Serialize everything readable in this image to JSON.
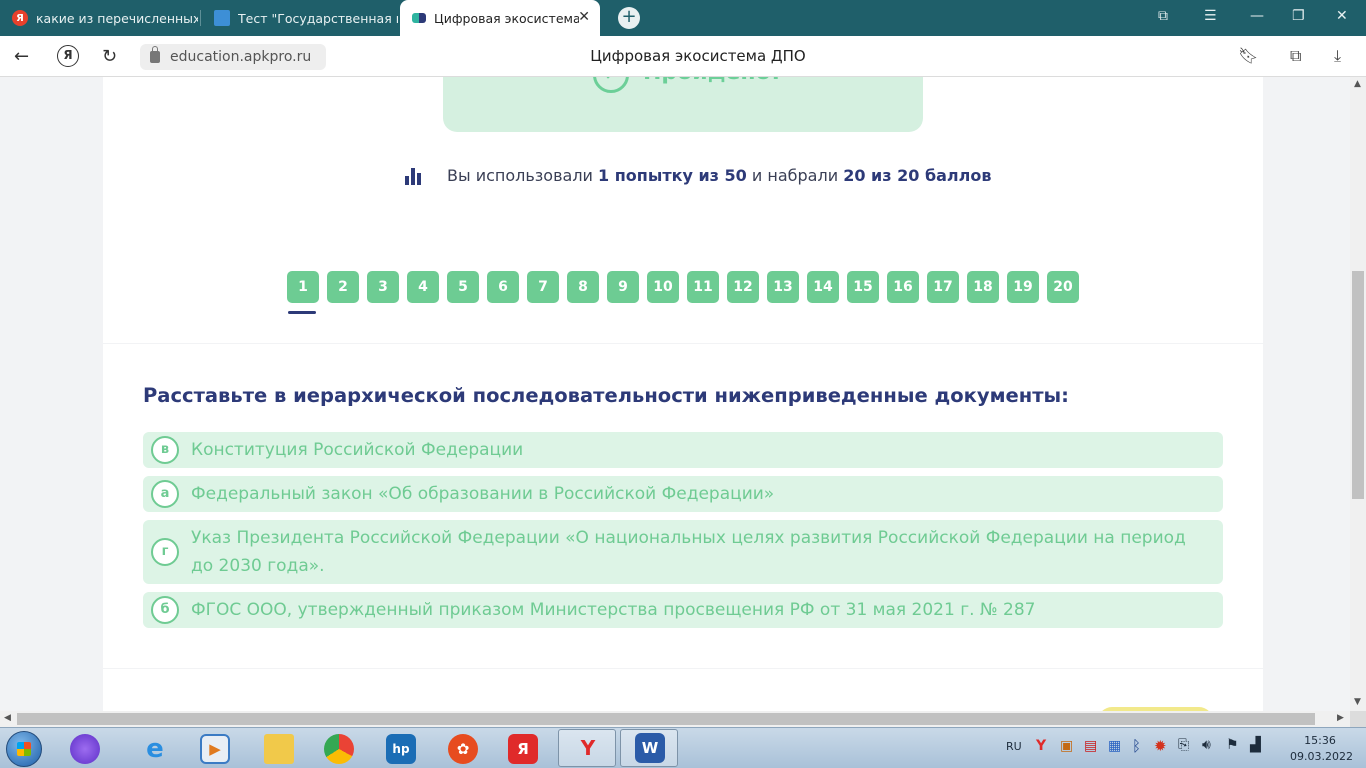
{
  "browser": {
    "tabs": [
      {
        "title": "какие из перечисленных т",
        "favicon": "yandex-icon"
      },
      {
        "title": "Тест \"Государственная пол",
        "favicon": "book-icon"
      },
      {
        "title": "Цифровая экосистема ДПО",
        "favicon": "site-logo-icon",
        "active": true
      }
    ],
    "url": "education.apkpro.ru",
    "page_title": "Цифровая экосистема ДПО"
  },
  "result": {
    "status_label": "Пройдено!",
    "stats": {
      "prefix": "Вы использовали",
      "attempts": "1 попытку из 50",
      "middle": "и набрали",
      "score": "20 из 20 баллов"
    },
    "question_numbers": [
      "1",
      "2",
      "3",
      "4",
      "5",
      "6",
      "7",
      "8",
      "9",
      "10",
      "11",
      "12",
      "13",
      "14",
      "15",
      "16",
      "17",
      "18",
      "19",
      "20"
    ],
    "active_question": "1"
  },
  "question": {
    "text": "Расставьте в иерархической последовательности нижеприведенные документы:",
    "answers": [
      {
        "letter": "в",
        "text": "Конституция Российской Федерации"
      },
      {
        "letter": "а",
        "text": "Федеральный закон «Об образовании в Российской Федерации»"
      },
      {
        "letter": "г",
        "text": "Указ Президента Российской Федерации «О национальных целях развития Российской Федерации на период до 2030 года»."
      },
      {
        "letter": "б",
        "text": "ФГОС ООО, утвержденный приказом Министерства просвещения РФ от 31 мая 2021 г. № 287"
      }
    ]
  },
  "taskbar": {
    "lang": "RU",
    "time": "15:36",
    "date": "09.03.2022"
  },
  "colors": {
    "accent_green": "#6dcc93",
    "answer_bg": "#ddf4e6",
    "heading_blue": "#2d3a78",
    "tab_bar": "#1f5f6a"
  }
}
